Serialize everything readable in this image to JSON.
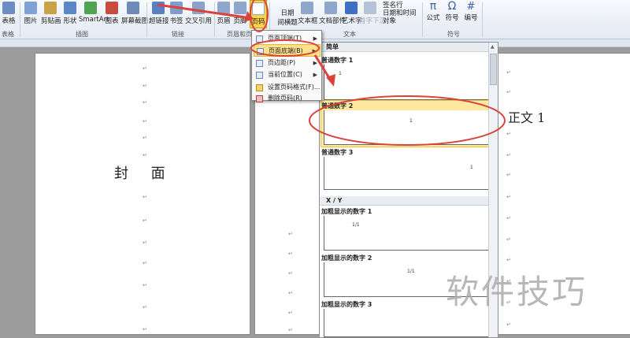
{
  "ribbon": {
    "buttons": [
      {
        "id": "table",
        "label": "表格",
        "color": "#6b8fc4"
      },
      {
        "id": "picture",
        "label": "图片",
        "color": "#7fa1d6"
      },
      {
        "id": "clipart",
        "label": "剪贴画",
        "color": "#c9a24a"
      },
      {
        "id": "shapes",
        "label": "形状",
        "color": "#5b86c9"
      },
      {
        "id": "smartart",
        "label": "SmartArt",
        "color": "#52a34f"
      },
      {
        "id": "chart",
        "label": "图表",
        "color": "#c84c3c"
      },
      {
        "id": "screenshot",
        "label": "屏幕截图",
        "color": "#6e8ab6"
      },
      {
        "id": "hyperlink",
        "label": "超链接",
        "color": "#5a7fc4"
      },
      {
        "id": "bookmark",
        "label": "书签",
        "color": "#7f9dcc"
      },
      {
        "id": "crossref",
        "label": "交叉引用",
        "color": "#8aa2c9"
      },
      {
        "id": "header",
        "label": "页眉",
        "color": "#8ea6cc"
      },
      {
        "id": "footer",
        "label": "页脚",
        "color": "#8ea6cc"
      },
      {
        "id": "pagenumber",
        "label": "页码",
        "color": "#8ea6cc"
      },
      {
        "id": "textbox",
        "label": "文本框",
        "color": "#8ea6cc"
      },
      {
        "id": "quickparts",
        "label": "文档部件",
        "color": "#8ea6cc"
      },
      {
        "id": "wordart",
        "label": "艺术字",
        "color": "#3d6fc4"
      },
      {
        "id": "dropcap",
        "label": "首字下沉",
        "color": "#9aa9c0"
      },
      {
        "id": "equation",
        "label": "公式",
        "color": "#3b5fa3"
      },
      {
        "id": "symbol",
        "label": "符号",
        "color": "#3b5fa3"
      },
      {
        "id": "number",
        "label": "编号",
        "color": "#8ea6cc"
      }
    ],
    "extra_labels": {
      "date_label": "日期",
      "date_sub": "间横题",
      "datetime": "日期和时间",
      "object": "对象",
      "sig": "签名行",
      "pi_glyph": "π",
      "omega_glyph": "Ω",
      "ab_glyph": "#"
    },
    "groups": {
      "tables": "表格",
      "illustrations": "插图",
      "links": "链接",
      "header_footer": "页眉和页脚",
      "text": "文本",
      "symbols": "符号"
    }
  },
  "page_number_menu": {
    "items": [
      {
        "label": "页面顶端(T)",
        "submenu": true
      },
      {
        "label": "页面底端(B)",
        "submenu": true
      },
      {
        "label": "页边距(P)",
        "submenu": true
      },
      {
        "label": "当前位置(C)",
        "submenu": true
      },
      {
        "label": "设置页码格式(F)...",
        "submenu": false
      },
      {
        "label": "删除页码(R)",
        "submenu": false
      }
    ]
  },
  "gallery": {
    "section_simple": "简单",
    "section_xy": "X / Y",
    "items": [
      {
        "label": "普通数字 1",
        "num": "1"
      },
      {
        "label": "普通数字 2",
        "num": "1"
      },
      {
        "label": "普通数字 3",
        "num": "1"
      },
      {
        "label": "加粗显示的数字 1",
        "num": "1/1"
      },
      {
        "label": "加粗显示的数字 2",
        "num": "1/1"
      },
      {
        "label": "加粗显示的数字 3",
        "num": ""
      }
    ]
  },
  "document": {
    "cover_text": "封     面",
    "body_text": "正文 1",
    "para_mark": "↵"
  },
  "watermark": "软件技巧",
  "colors": {
    "highlight": "#ffe9a0",
    "annotation": "#d9433a",
    "selected_tab": "#ffd24a"
  }
}
